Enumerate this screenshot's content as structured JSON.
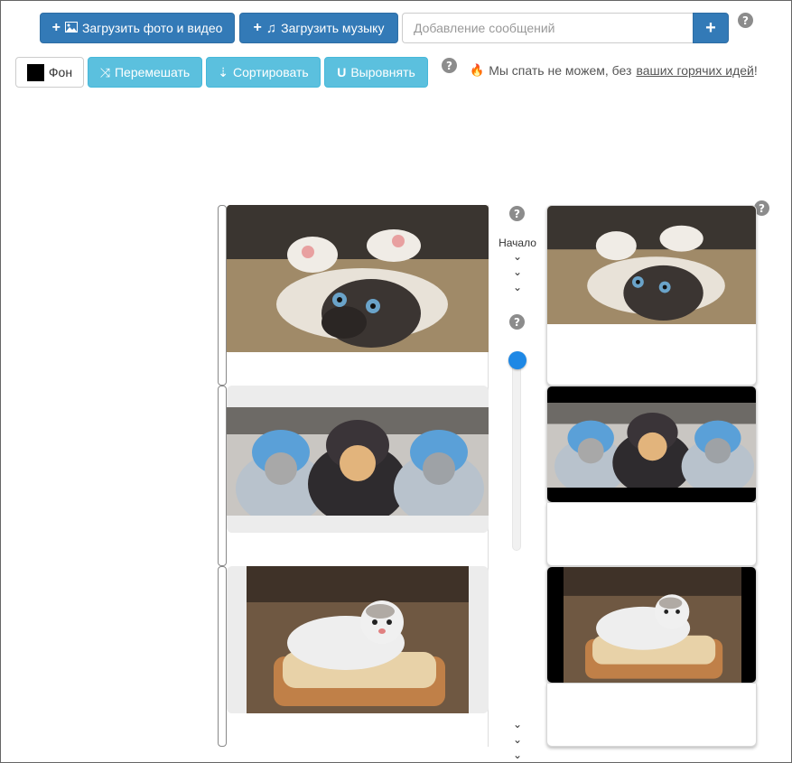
{
  "toolbar": {
    "upload_media_label": "Загрузить фото и видео",
    "upload_music_label": "Загрузить музыку",
    "message_placeholder": "Добавление сообщений",
    "add_message_label": "+",
    "help_symbol": "?",
    "background_label": "Фон",
    "background_color": "#000000",
    "shuffle_label": "Перемешать",
    "sort_label": "Сортировать",
    "align_label": "Выровнять"
  },
  "promo": {
    "text_before": "Мы спать не можем, без",
    "link_text": "ваших горячих идей",
    "text_after": "!"
  },
  "timeline": {
    "start_label": "Начало",
    "chevron": "⌄",
    "slider_level": 0.0
  },
  "slides": [
    {
      "name": "kitten-on-back",
      "left_fit": "fill-top",
      "right_fit": "fill-top"
    },
    {
      "name": "kittens-in-hats",
      "left_fit": "letterbox-gray",
      "right_fit": "letterbox-black"
    },
    {
      "name": "cat-on-bread",
      "left_fit": "pillarbox-gray",
      "right_fit": "pillarbox-black"
    }
  ],
  "colors": {
    "primary": "#337ab7",
    "info": "#5bc0de",
    "slider": "#1e88e5"
  }
}
